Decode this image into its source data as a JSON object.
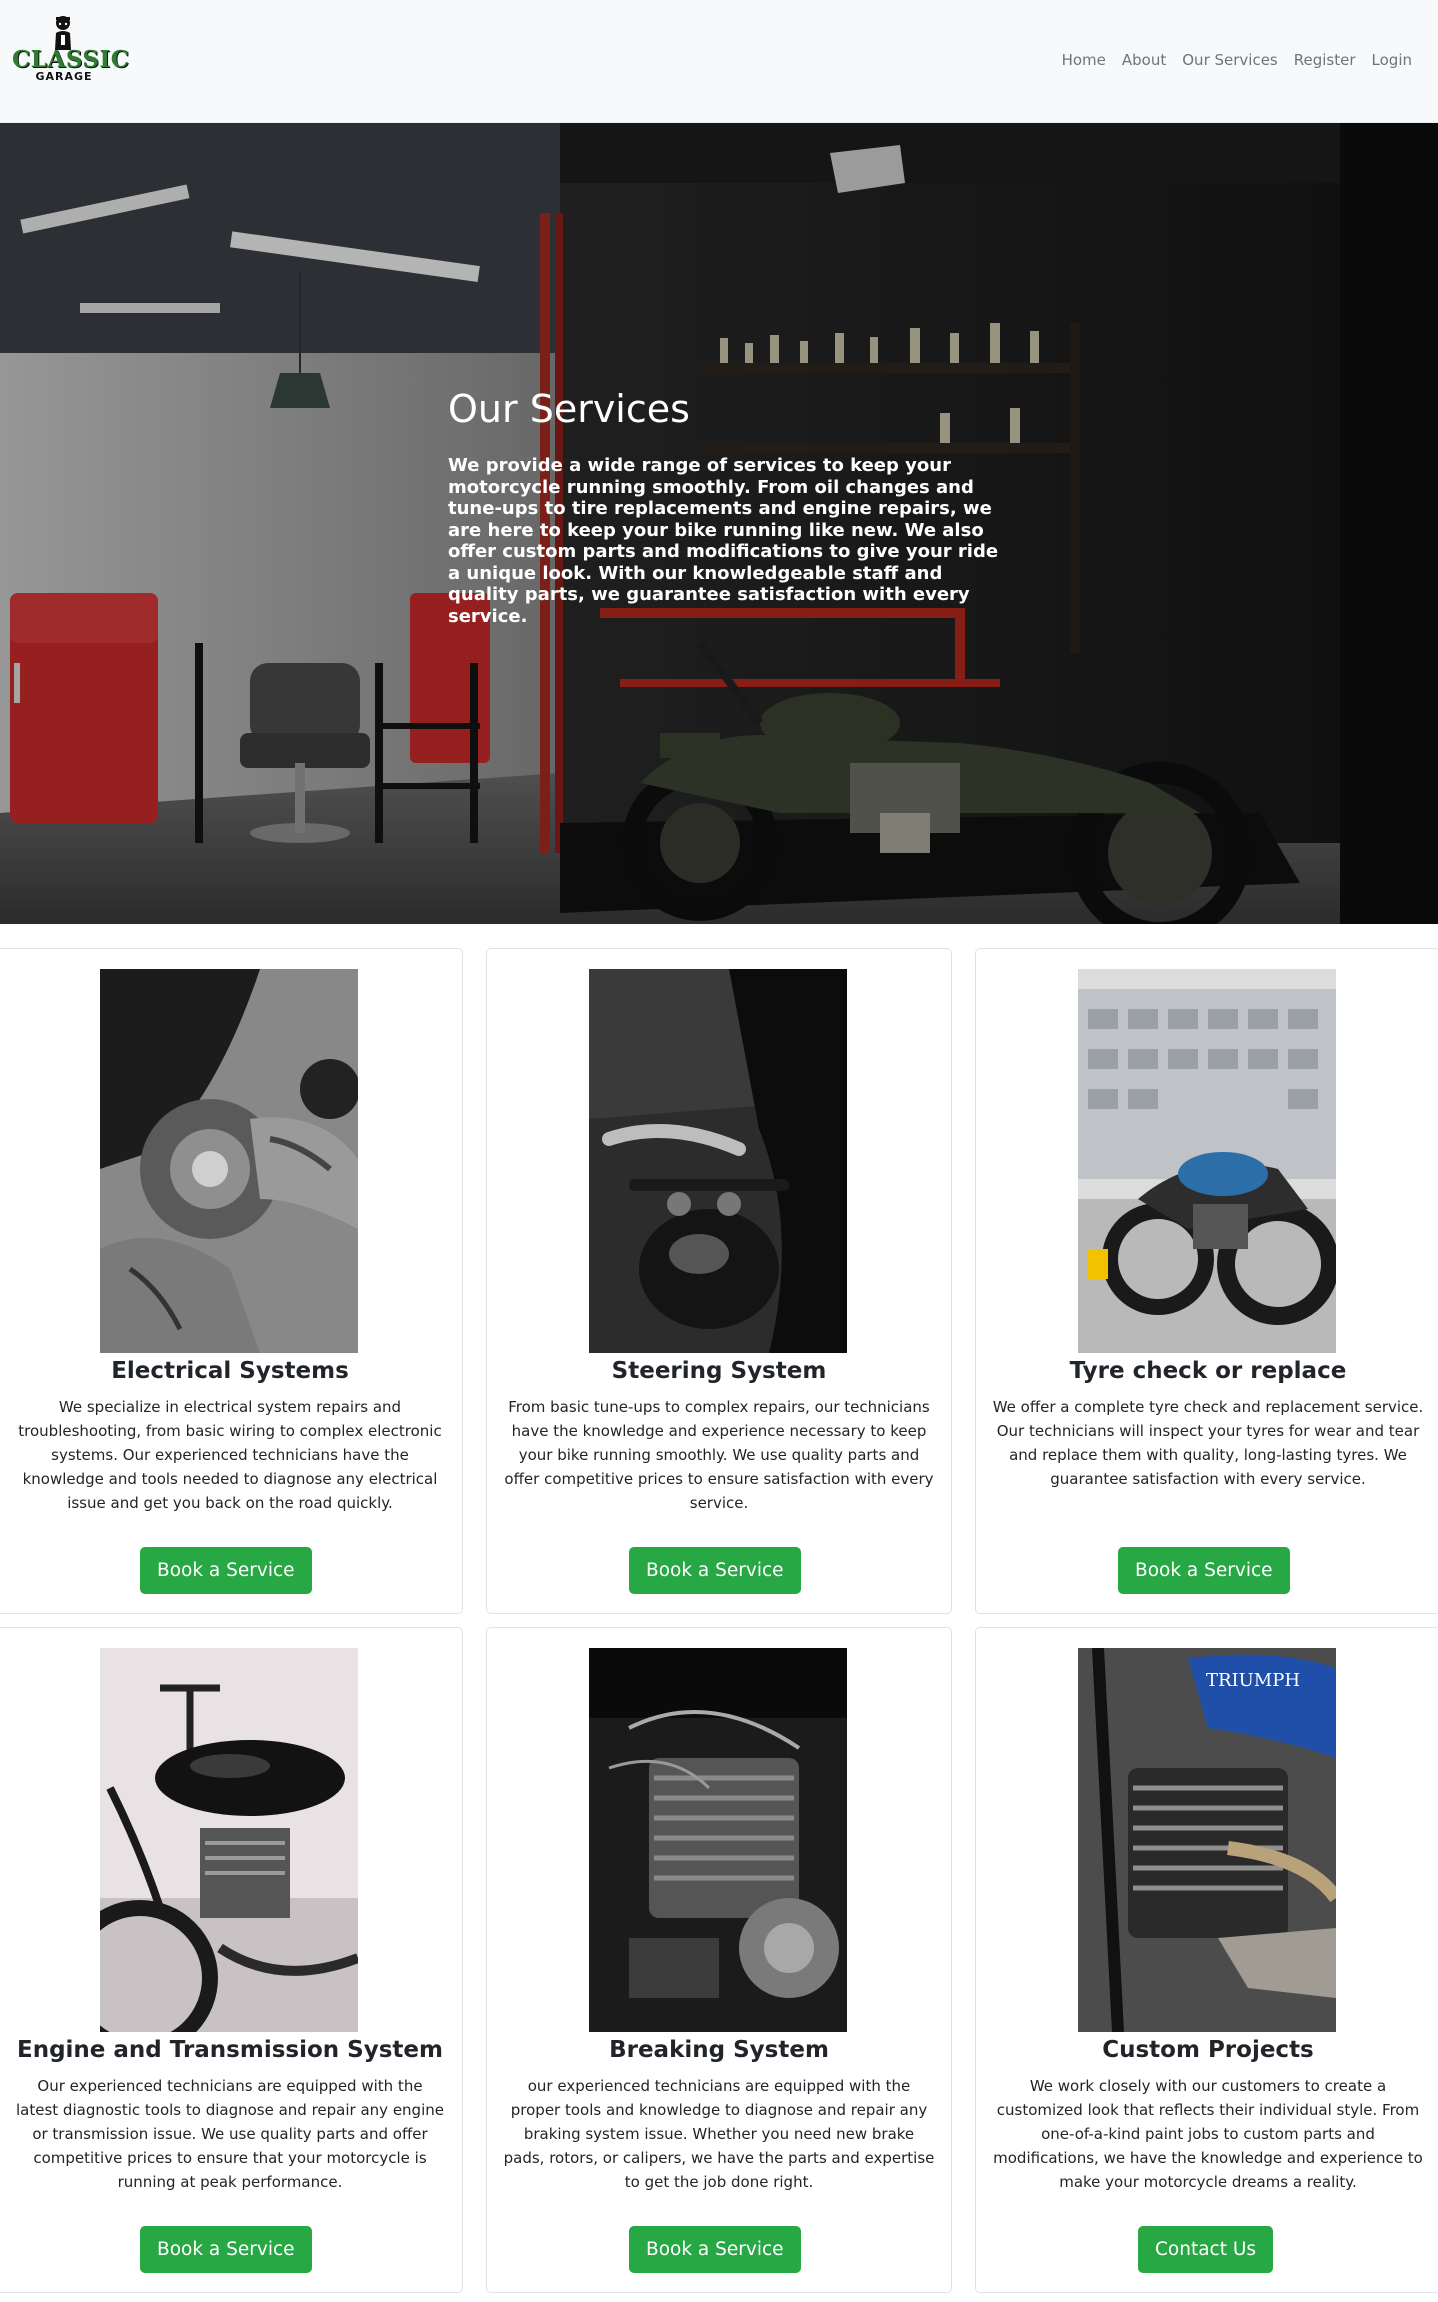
{
  "brand": {
    "name": "CLASSIC",
    "sub": "GARAGE",
    "icon": "mechanic-mascot-icon",
    "color": "#2e7d32"
  },
  "nav": {
    "items": [
      {
        "label": "Home"
      },
      {
        "label": "About"
      },
      {
        "label": "Our Services"
      },
      {
        "label": "Register"
      },
      {
        "label": "Login"
      }
    ]
  },
  "hero": {
    "title": "Our Services",
    "body": "We provide a wide range of services to keep your motorcycle running smoothly. From oil changes and tune-ups to tire replacements and engine repairs, we are here to keep your bike running like new. We also offer custom parts and modifications to give your ride a unique look. With our knowledgeable staff and quality parts, we guarantee satisfaction with every service."
  },
  "services": [
    {
      "title": "Electrical Systems",
      "text": "We specialize in electrical system repairs and troubleshooting, from basic wiring to complex electronic systems. Our experienced technicians have the knowledge and tools needed to diagnose any electrical issue and get you back on the road quickly.",
      "button": "Book a Service"
    },
    {
      "title": "Steering System",
      "text": "From basic tune-ups to complex repairs, our technicians have the knowledge and experience necessary to keep your bike running smoothly. We use quality parts and offer competitive prices to ensure satisfaction with every service.",
      "button": "Book a Service"
    },
    {
      "title": "Tyre check or replace",
      "text": "We offer a complete tyre check and replacement service. Our technicians will inspect your tyres for wear and tear and replace them with quality, long-lasting tyres. We guarantee satisfaction with every service.",
      "button": "Book a Service"
    },
    {
      "title": "Engine and Transmission System",
      "text": "Our experienced technicians are equipped with the latest diagnostic tools to diagnose and repair any engine or transmission issue. We use quality parts and offer competitive prices to ensure that your motorcycle is running at peak performance.",
      "button": "Book a Service"
    },
    {
      "title": "Breaking System",
      "text": "our experienced technicians are equipped with the proper tools and knowledge to diagnose and repair any braking system issue. Whether you need new brake pads, rotors, or calipers, we have the parts and expertise to get the job done right.",
      "button": "Book a Service"
    },
    {
      "title": "Custom Projects",
      "text": "We work closely with our customers to create a customized look that reflects their individual style. From one-of-a-kind paint jobs to custom parts and modifications, we have the knowledge and experience to make your motorcycle dreams a reality.",
      "button": "Contact Us",
      "image_text": "TRIUMPH"
    }
  ],
  "colors": {
    "button": "#28a745",
    "navbar": "#f8f9fa"
  }
}
